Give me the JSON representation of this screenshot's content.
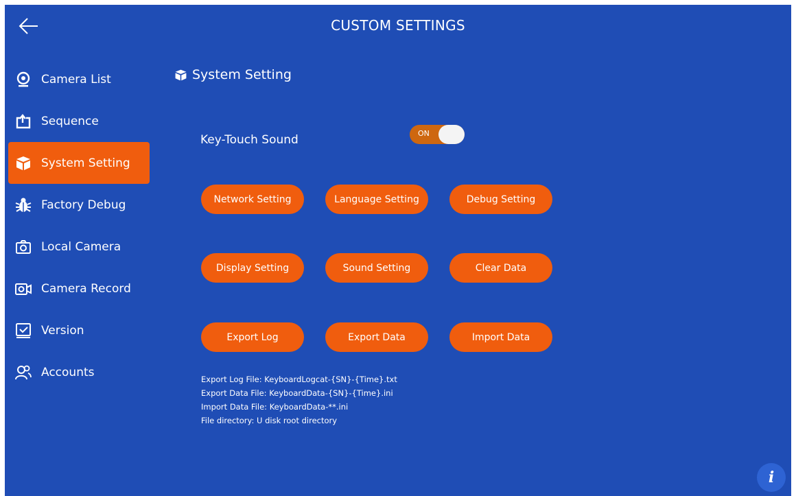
{
  "header": {
    "title": "CUSTOM SETTINGS",
    "back_icon": "arrow-left-icon"
  },
  "sidebar": {
    "items": [
      {
        "label": "Camera List",
        "icon": "webcam-icon"
      },
      {
        "label": "Sequence",
        "icon": "sequence-icon"
      },
      {
        "label": "System Setting",
        "icon": "box-icon",
        "active": true
      },
      {
        "label": "Factory Debug",
        "icon": "bug-icon"
      },
      {
        "label": "Local Camera",
        "icon": "camera-icon"
      },
      {
        "label": "Camera Record",
        "icon": "video-camera-icon"
      },
      {
        "label": "Version",
        "icon": "version-icon"
      },
      {
        "label": "Accounts",
        "icon": "users-icon"
      }
    ]
  },
  "main": {
    "section_title": "System Setting",
    "key_touch": {
      "label": "Key-Touch Sound",
      "toggle_text": "ON",
      "on": true
    },
    "buttons": {
      "network": "Network Setting",
      "language": "Language Setting",
      "debug": "Debug Setting",
      "display": "Display Setting",
      "sound": "Sound Setting",
      "clear": "Clear Data",
      "export_log": "Export Log",
      "export_data": "Export Data",
      "import_data": "Import Data"
    },
    "notes": [
      "Export Log File: KeyboardLogcat-{SN}-{Time}.txt",
      "Export Data File: KeyboardData-{SN}-{Time}.ini",
      "Import Data File: KeyboardData-**.ini",
      "File directory: U disk root directory"
    ]
  },
  "info_button": {
    "label": "i"
  },
  "colors": {
    "background": "#1f4db5",
    "accent": "#f05d0e",
    "toggle_on": "#ce6710"
  }
}
